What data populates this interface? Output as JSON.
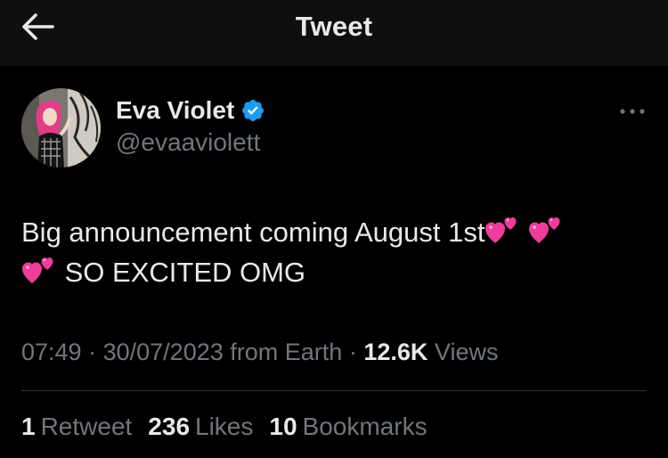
{
  "header": {
    "title": "Tweet",
    "back_icon": "arrow-left-icon"
  },
  "author": {
    "display_name": "Eva Violet",
    "handle": "@evaaviolett",
    "verified": true,
    "verified_color": "#1d9bf0"
  },
  "tweet": {
    "text_part1": "Big announcement coming August 1st",
    "emoji": "two-hearts-emoji",
    "text_part2": "SO EXCITED OMG"
  },
  "meta": {
    "time": "07:49",
    "date": "30/07/2023",
    "source": "from Earth",
    "views_count": "12.6K",
    "views_label": "Views"
  },
  "stats": [
    {
      "count": "1",
      "label": "Retweet"
    },
    {
      "count": "236",
      "label": "Likes"
    },
    {
      "count": "10",
      "label": "Bookmarks"
    }
  ],
  "colors": {
    "background": "#000000",
    "header_background": "#0f0f10",
    "primary_text": "#e7e9ea",
    "secondary_text": "#71767b",
    "divider": "#2f3336",
    "heart_pink": "#f03c9a"
  }
}
